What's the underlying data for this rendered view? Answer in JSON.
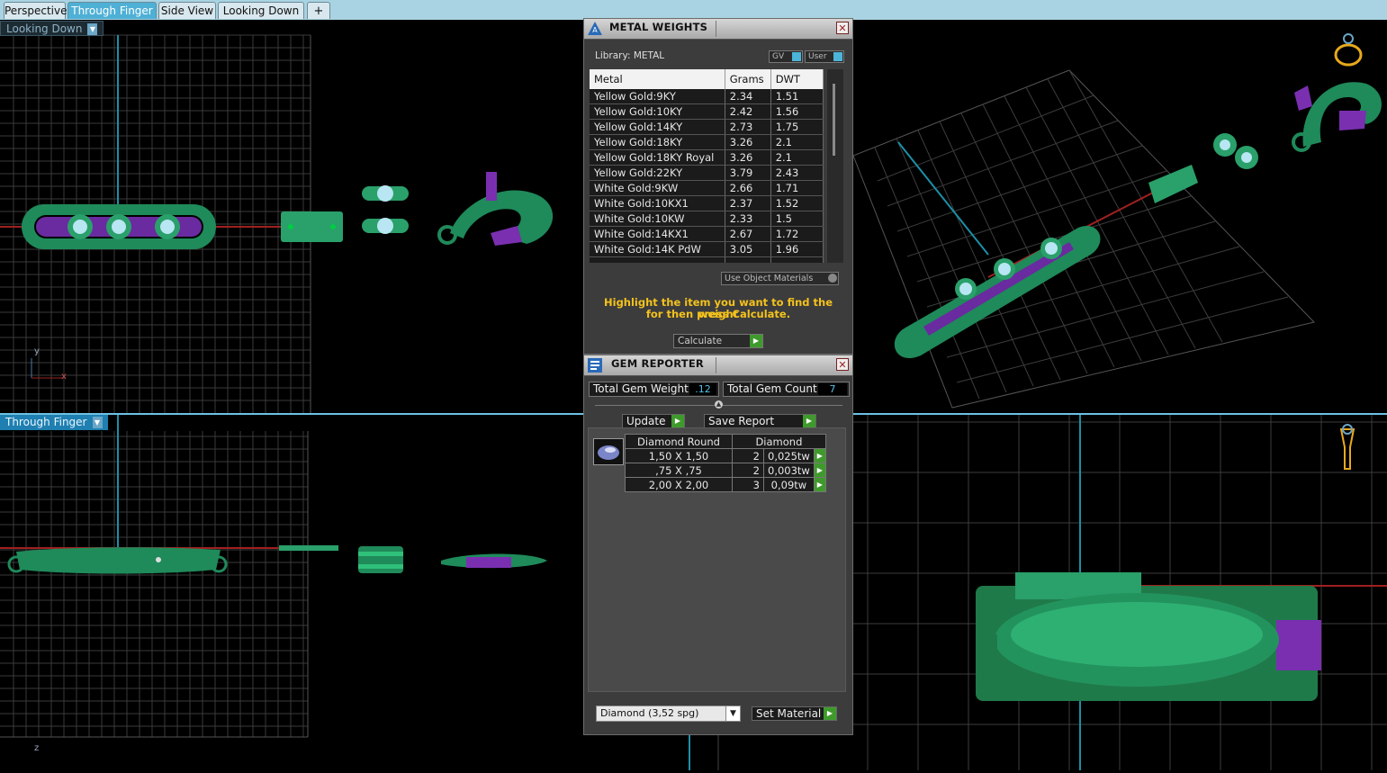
{
  "tabs": [
    {
      "label": "Perspective",
      "active": false
    },
    {
      "label": "Through Finger",
      "active": true
    },
    {
      "label": "Side View",
      "active": false
    },
    {
      "label": "Looking Down",
      "active": false
    }
  ],
  "add_tab_glyph": "+",
  "viewports": {
    "top_left_label": "Looking Down",
    "bottom_left_label": "Through Finger",
    "axis_y": "y",
    "axis_x": "x",
    "axis_z": "z"
  },
  "metal_weights": {
    "title": "METAL WEIGHTS",
    "library_label": "Library: METAL",
    "gv_label": "GV",
    "user_label": "User",
    "columns": [
      "Metal",
      "Grams",
      "DWT"
    ],
    "rows": [
      [
        "Yellow Gold:9KY",
        "2.34",
        "1.51"
      ],
      [
        "Yellow Gold:10KY",
        "2.42",
        "1.56"
      ],
      [
        "Yellow Gold:14KY",
        "2.73",
        "1.75"
      ],
      [
        "Yellow Gold:18KY",
        "3.26",
        "2.1"
      ],
      [
        "Yellow Gold:18KY Royal",
        "3.26",
        "2.1"
      ],
      [
        "Yellow Gold:22KY",
        "3.79",
        "2.43"
      ],
      [
        "White Gold:9KW",
        "2.66",
        "1.71"
      ],
      [
        "White Gold:10KX1",
        "2.37",
        "1.52"
      ],
      [
        "White Gold:10KW",
        "2.33",
        "1.5"
      ],
      [
        "White Gold:14KX1",
        "2.67",
        "1.72"
      ],
      [
        "White Gold:14K PdW",
        "3.05",
        "1.96"
      ]
    ],
    "use_object_materials": "Use Object Materials",
    "instruction_line1": "Highlight the item you want to find the weight",
    "instruction_line2": "for then press Calculate.",
    "calculate_label": "Calculate"
  },
  "gem_reporter": {
    "title": "GEM REPORTER",
    "total_weight_label": "Total Gem Weight",
    "total_weight_value": ".12",
    "total_count_label": "Total Gem Count",
    "total_count_value": "7",
    "update_label": "Update",
    "save_report_label": "Save Report",
    "group_name": "Diamond Round",
    "group_material": "Diamond",
    "rows": [
      {
        "size": "1,50 X 1,50",
        "count": "2",
        "weight": "0,025tw"
      },
      {
        "size": ",75 X ,75",
        "count": "2",
        "weight": "0,003tw"
      },
      {
        "size": "2,00 X 2,00",
        "count": "3",
        "weight": "0,09tw"
      }
    ],
    "material_select": "Diamond    (3,52 spg)",
    "set_material_label": "Set Material"
  },
  "colors": {
    "accent": "#4fb0d6",
    "model_green": "#1f8a5a",
    "model_purple": "#7a2fb0",
    "warning_text": "#f4c21c",
    "go_green": "#3f9a2c"
  }
}
